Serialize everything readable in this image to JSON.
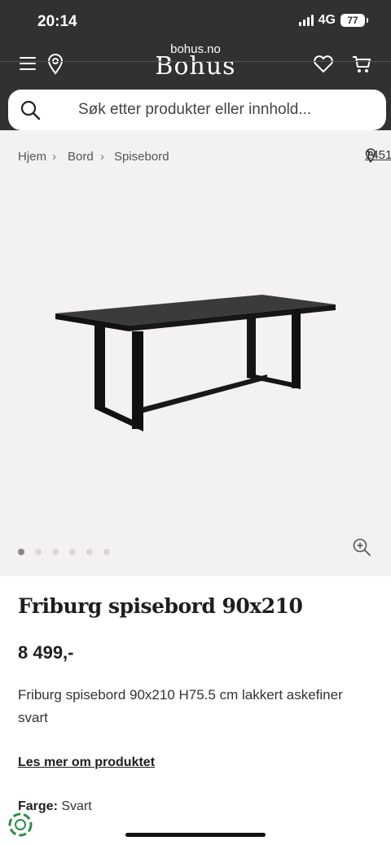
{
  "status": {
    "time": "20:14",
    "network": "4G",
    "battery": "77"
  },
  "browser": {
    "url": "bohus.no"
  },
  "header": {
    "logo": "Bohus"
  },
  "search": {
    "placeholder": "Søk etter produkter eller innhold..."
  },
  "breadcrumb": {
    "items": [
      "Hjem",
      "Bord",
      "Spisebord"
    ],
    "separator": "›",
    "store_number": "1451"
  },
  "gallery": {
    "image_count": 6,
    "active_index": 0
  },
  "product": {
    "title": "Friburg spisebord 90x210",
    "price": "8 499,-",
    "description": "Friburg spisebord 90x210 H75.5 cm lakkert askefiner svart",
    "read_more": "Les mer om produktet",
    "color_label": "Farge:",
    "color_value": "Svart"
  },
  "colors": {
    "header_bg": "#2f3133",
    "image_bg": "#f4f2f0"
  }
}
